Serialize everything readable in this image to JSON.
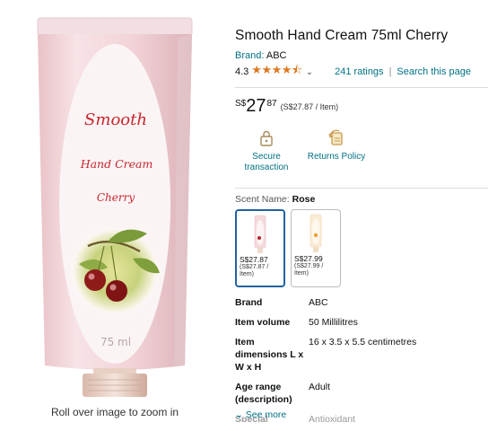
{
  "product_image": {
    "text_line1": "Smooth",
    "text_line2": "Hand Cream",
    "text_line3": "Cherry",
    "volume_text": "75 ml",
    "zoom_hint": "Roll over image to zoom in"
  },
  "product": {
    "title": "Smooth Hand Cream 75ml Cherry",
    "brand_label": "Brand:",
    "brand_name": "ABC",
    "rating_value": "4.3",
    "stars": "★★★★⯪",
    "ratings_link": "241 ratings",
    "separator": "|",
    "search_link": "Search this page"
  },
  "price": {
    "currency": "S$",
    "whole": "27",
    "fraction": "87",
    "unit_price": "(S$27.87 / Item)"
  },
  "features": [
    {
      "icon": "lock-icon",
      "label": "Secure transaction"
    },
    {
      "icon": "return-icon",
      "label": "Returns Policy"
    }
  ],
  "scent": {
    "label": "Scent Name:",
    "value": "Rose",
    "variants": [
      {
        "price": "S$27.87",
        "unit": "(S$27.87 / Item)",
        "selected": true
      },
      {
        "price": "S$27.99",
        "unit": "(S$27.99 / Item)",
        "selected": false
      }
    ]
  },
  "specs": [
    {
      "key": "Brand",
      "value": "ABC"
    },
    {
      "key": "Item volume",
      "value": "50 Millilitres"
    },
    {
      "key": "Item dimensions L x W x H",
      "value": "16 x 3.5 x 5.5 centimetres"
    },
    {
      "key": "Age range (description)",
      "value": "Adult"
    },
    {
      "key": "Special",
      "value": "Antioxidant"
    }
  ],
  "see_more": "See more",
  "colors": {
    "link": "#007185",
    "star": "#de7921",
    "selected_border": "#2162a1",
    "tube_pink": "#f3d6da",
    "label_red": "#c8262d"
  }
}
